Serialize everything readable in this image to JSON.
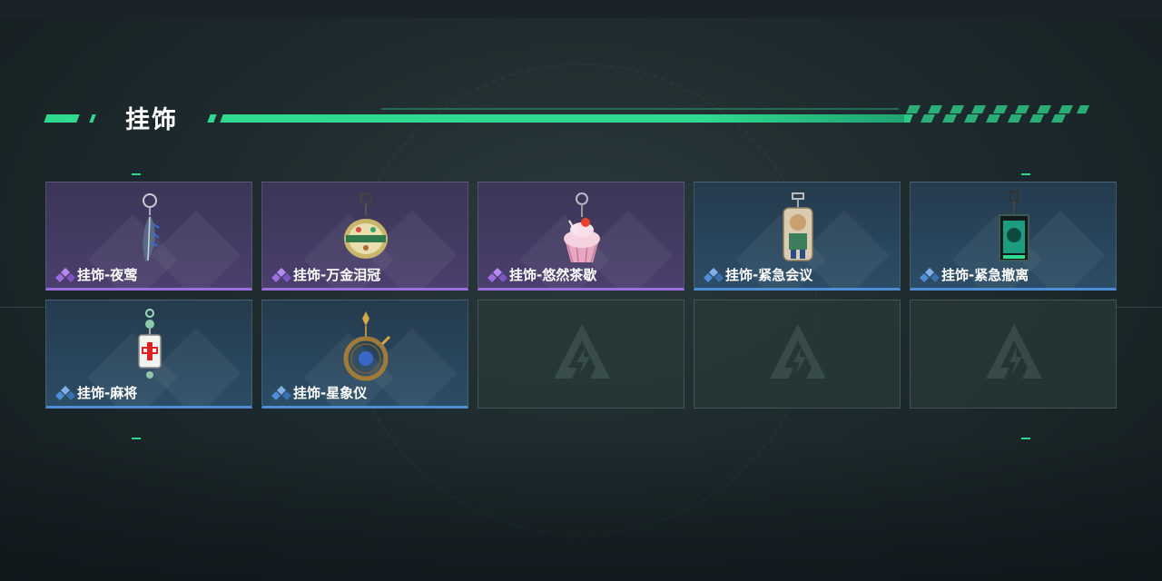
{
  "section": {
    "title": "挂饰"
  },
  "colors": {
    "accent": "#2fd98f",
    "purple_rarity": "#9b6ddf",
    "blue_rarity": "#4f8ed6"
  },
  "items": [
    {
      "name": "挂饰-夜莺",
      "rarity": "purple",
      "icon": "feather-charm-icon"
    },
    {
      "name": "挂饰-万金泪冠",
      "rarity": "purple",
      "icon": "jeweled-crown-charm-icon"
    },
    {
      "name": "挂饰-悠然茶歇",
      "rarity": "purple",
      "icon": "cupcake-charm-icon"
    },
    {
      "name": "挂饰-紧急会议",
      "rarity": "blue",
      "icon": "figure-charm-icon"
    },
    {
      "name": "挂饰-紧急撤离",
      "rarity": "blue",
      "icon": "green-tag-charm-icon"
    },
    {
      "name": "挂饰-麻将",
      "rarity": "blue",
      "icon": "mahjong-tile-charm-icon"
    },
    {
      "name": "挂饰-星象仪",
      "rarity": "blue",
      "icon": "astrolabe-charm-icon"
    }
  ],
  "empty_slots": 3
}
